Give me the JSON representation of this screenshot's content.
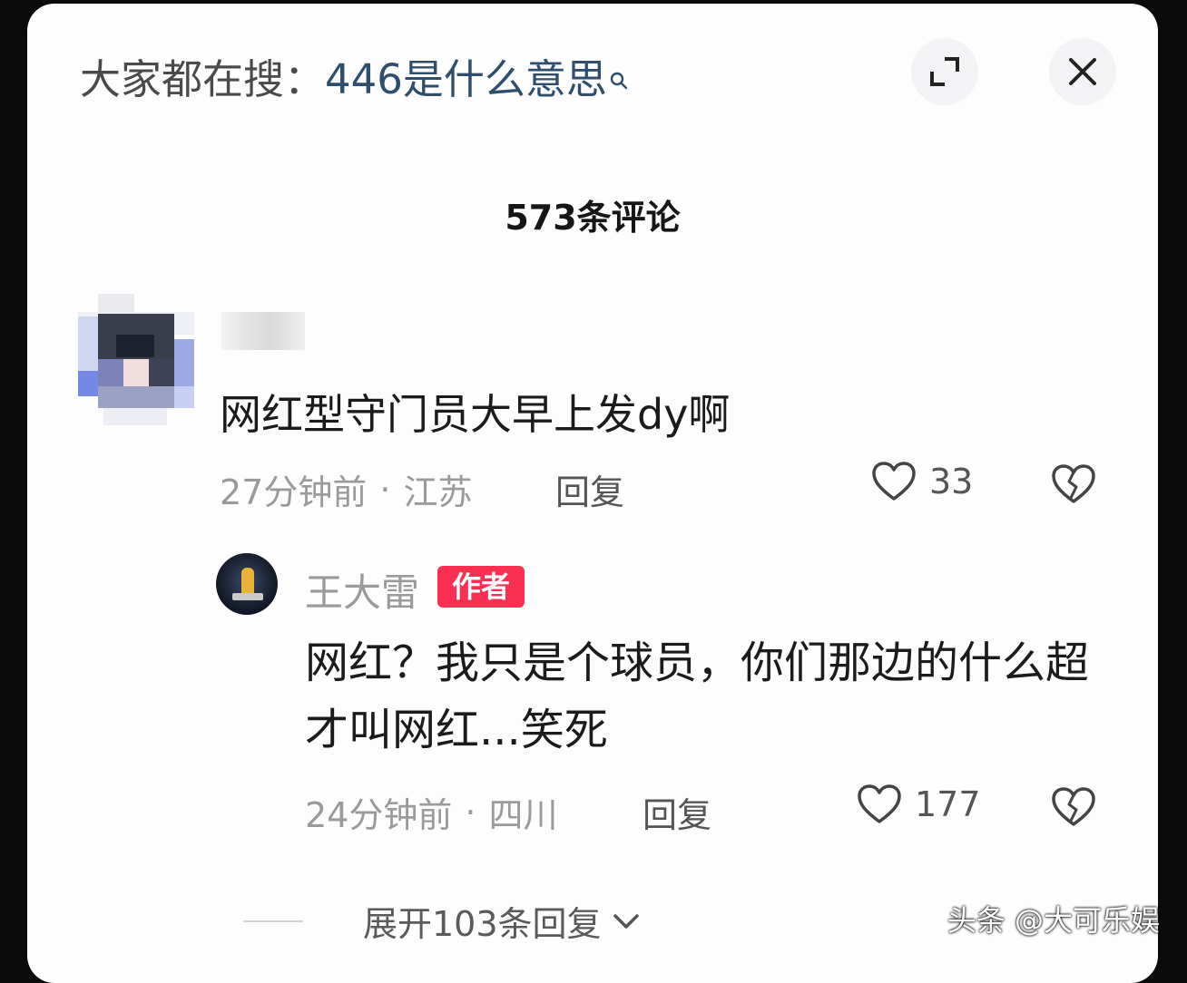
{
  "search": {
    "label": "大家都在搜：",
    "query": "446是什么意思"
  },
  "header": {
    "comments_count_title": "573条评论"
  },
  "comments": [
    {
      "text": "网红型守门员大早上发dy啊",
      "time": "27分钟前",
      "location": "江苏",
      "reply_label": "回复",
      "likes": "33"
    }
  ],
  "reply": {
    "author": "王大雷",
    "badge": "作者",
    "text": "网红？我只是个球员，你们那边的什么超才叫网红...笑死",
    "time": "24分钟前",
    "location": "四川",
    "reply_label": "回复",
    "likes": "177"
  },
  "expand": {
    "label": "展开103条回复"
  },
  "watermark": "头条 @大可乐娱",
  "colors": {
    "badge": "#fa3052",
    "query": "#2f4e6e"
  }
}
